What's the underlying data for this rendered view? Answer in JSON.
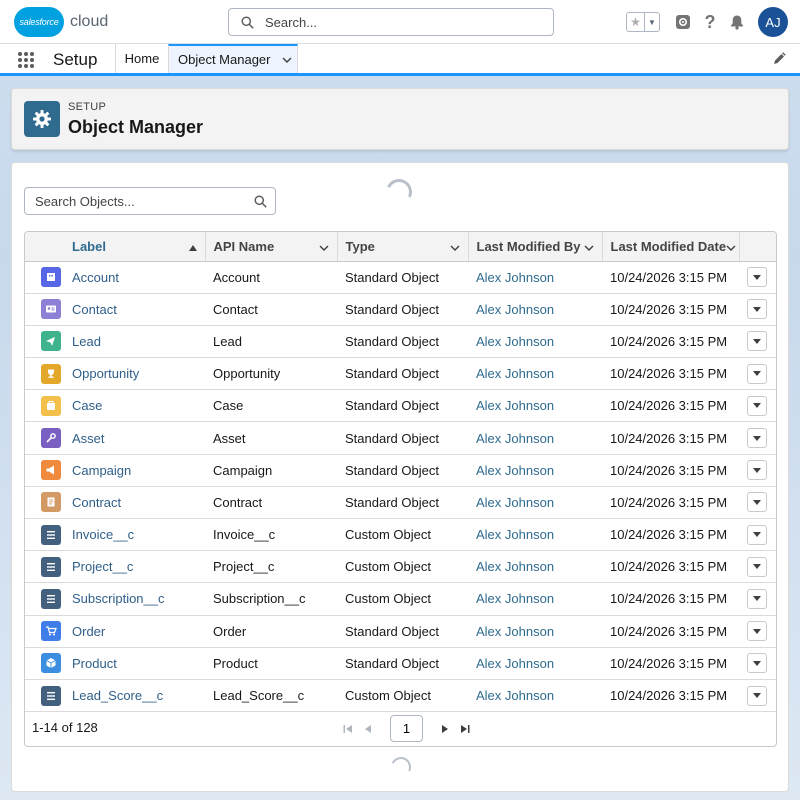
{
  "header": {
    "logo_badge": "salesforce",
    "logo_text": "cloud",
    "search_placeholder": "Search...",
    "avatar_initials": "AJ"
  },
  "context_bar": {
    "app_name": "Setup",
    "tabs": [
      {
        "label": "Home"
      },
      {
        "label": "Object Manager"
      }
    ]
  },
  "page_header": {
    "eyebrow": "SETUP",
    "title": "Object Manager"
  },
  "object_search": {
    "placeholder": "Search Objects..."
  },
  "table": {
    "columns": [
      "Label",
      "API Name",
      "Type",
      "Last Modified By",
      "Last Modified Date"
    ],
    "sorted_column": "Label",
    "rows": [
      {
        "label": "Account",
        "api": "Account",
        "type": "Standard Object",
        "by": "Alex Johnson",
        "date": "10/24/2026 3:15 PM",
        "icon": "account-icon",
        "color": "#5867e8"
      },
      {
        "label": "Contact",
        "api": "Contact",
        "type": "Standard Object",
        "by": "Alex Johnson",
        "date": "10/24/2026 3:15 PM",
        "icon": "contact-icon",
        "color": "#8b7fd6"
      },
      {
        "label": "Lead",
        "api": "Lead",
        "type": "Standard Object",
        "by": "Alex Johnson",
        "date": "10/24/2026 3:15 PM",
        "icon": "lead-icon",
        "color": "#3fb38d"
      },
      {
        "label": "Opportunity",
        "api": "Opportunity",
        "type": "Standard Object",
        "by": "Alex Johnson",
        "date": "10/24/2026 3:15 PM",
        "icon": "opportunity-icon",
        "color": "#e3a82a"
      },
      {
        "label": "Case",
        "api": "Case",
        "type": "Standard Object",
        "by": "Alex Johnson",
        "date": "10/24/2026 3:15 PM",
        "icon": "case-icon",
        "color": "#f2c04b"
      },
      {
        "label": "Asset",
        "api": "Asset",
        "type": "Standard Object",
        "by": "Alex Johnson",
        "date": "10/24/2026 3:15 PM",
        "icon": "asset-icon",
        "color": "#7a5fc2"
      },
      {
        "label": "Campaign",
        "api": "Campaign",
        "type": "Standard Object",
        "by": "Alex Johnson",
        "date": "10/24/2026 3:15 PM",
        "icon": "campaign-icon",
        "color": "#f08a3c"
      },
      {
        "label": "Contract",
        "api": "Contract",
        "type": "Standard Object",
        "by": "Alex Johnson",
        "date": "10/24/2026 3:15 PM",
        "icon": "contract-icon",
        "color": "#d49a66"
      },
      {
        "label": "Invoice__c",
        "api": "Invoice__c",
        "type": "Custom Object",
        "by": "Alex Johnson",
        "date": "10/24/2026 3:15 PM",
        "icon": "custom-object-icon",
        "color": "#43617f"
      },
      {
        "label": "Project__c",
        "api": "Project__c",
        "type": "Custom Object",
        "by": "Alex Johnson",
        "date": "10/24/2026 3:15 PM",
        "icon": "custom-object-icon",
        "color": "#43617f"
      },
      {
        "label": "Subscription__c",
        "api": "Subscription__c",
        "type": "Custom Object",
        "by": "Alex Johnson",
        "date": "10/24/2026 3:15 PM",
        "icon": "custom-object-icon",
        "color": "#43617f"
      },
      {
        "label": "Order",
        "api": "Order",
        "type": "Standard Object",
        "by": "Alex Johnson",
        "date": "10/24/2026 3:15 PM",
        "icon": "order-icon",
        "color": "#3f7ee8"
      },
      {
        "label": "Product",
        "api": "Product",
        "type": "Standard Object",
        "by": "Alex Johnson",
        "date": "10/24/2026 3:15 PM",
        "icon": "product-icon",
        "color": "#3c8fe0"
      },
      {
        "label": "Lead_Score__c",
        "api": "Lead_Score__c",
        "type": "Custom Object",
        "by": "Alex Johnson",
        "date": "10/24/2026 3:15 PM",
        "icon": "custom-object-icon",
        "color": "#43617f"
      }
    ]
  },
  "pagination": {
    "range_text": "1-14 of 128",
    "current_page": "1"
  }
}
